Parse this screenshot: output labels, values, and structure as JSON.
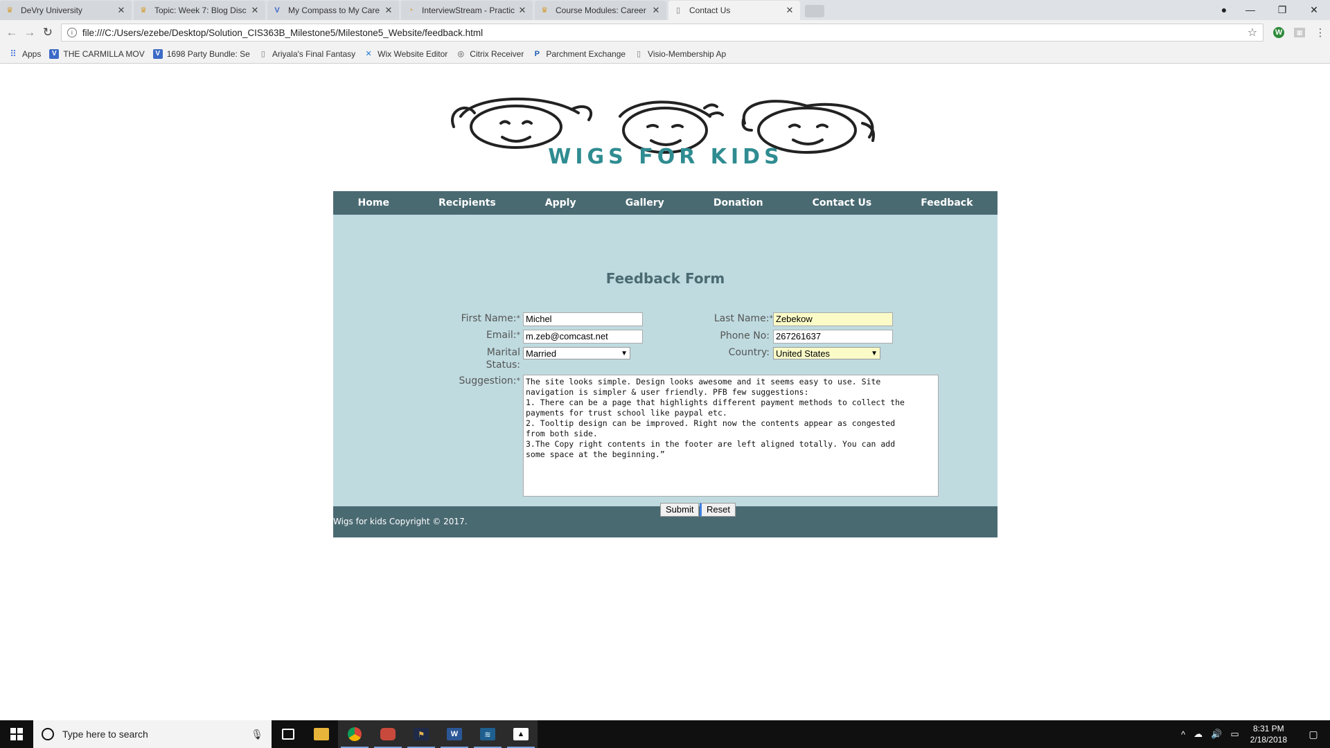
{
  "browser": {
    "tabs": [
      {
        "title": "DeVry University",
        "icon": "devry-favicon",
        "active": false
      },
      {
        "title": "Topic: Week 7: Blog Disc",
        "icon": "devry-favicon",
        "active": false
      },
      {
        "title": "My Compass to My Care",
        "icon": "v-favicon",
        "active": false
      },
      {
        "title": "InterviewStream - Practic",
        "icon": "interviewstream-favicon",
        "active": false
      },
      {
        "title": "Course Modules: Career",
        "icon": "devry-favicon",
        "active": false
      },
      {
        "title": "Contact Us",
        "icon": "document-favicon",
        "active": true
      }
    ],
    "tab_close_glyph": "✕",
    "url": "file:///C:/Users/ezebe/Desktop/Solution_CIS363B_Milestone5/Milestone5_Website/feedback.html",
    "bookmarks": [
      {
        "label": "Apps",
        "icon": "apps-grid-icon"
      },
      {
        "label": "THE CARMILLA MOV",
        "icon": "v-icon"
      },
      {
        "label": "1698 Party Bundle: Se",
        "icon": "v-icon"
      },
      {
        "label": "Ariyala's Final Fantasy",
        "icon": "document-icon"
      },
      {
        "label": "Wix Website Editor",
        "icon": "wix-icon"
      },
      {
        "label": "Citrix Receiver",
        "icon": "citrix-icon"
      },
      {
        "label": "Parchment Exchange",
        "icon": "parchment-icon"
      },
      {
        "label": "Visio-Membership Ap",
        "icon": "document-icon"
      }
    ]
  },
  "site": {
    "logo_text": "WIGS FOR KIDS",
    "nav": [
      "Home",
      "Recipients",
      "Apply",
      "Gallery",
      "Donation",
      "Contact Us",
      "Feedback"
    ],
    "form_title": "Feedback Form",
    "required_mark": "*",
    "labels": {
      "first_name": "First Name:",
      "last_name": "Last Name:",
      "email": "Email:",
      "phone": "Phone No:",
      "marital_line1": "Marital",
      "marital_line2": "Status:",
      "country": "Country:",
      "suggestion": "Suggestion:"
    },
    "values": {
      "first_name": "Michel",
      "last_name": "Zebekow",
      "email": "m.zeb@comcast.net",
      "phone": "267261637",
      "marital_status": "Married",
      "country": "United States",
      "suggestion": "The site looks simple. Design looks awesome and it seems easy to use. Site\nnavigation is simpler & user friendly. PFB few suggestions:\n1. There can be a page that highlights different payment methods to collect the\npayments for trust school like paypal etc.\n2. Tooltip design can be improved. Right now the contents appear as congested\nfrom both side.\n3.The Copy right contents in the footer are left aligned totally. You can add\nsome space at the beginning.”"
    },
    "buttons": {
      "submit": "Submit",
      "reset": "Reset"
    },
    "footer": "Wigs for kids Copyright © 2017."
  },
  "taskbar": {
    "search_placeholder": "Type here to search",
    "time": "8:31 PM",
    "date": "2/18/2018"
  },
  "colors": {
    "nav_bg": "#4a6a72",
    "content_bg": "#bfdbe0",
    "logo_teal": "#2f8c91"
  }
}
